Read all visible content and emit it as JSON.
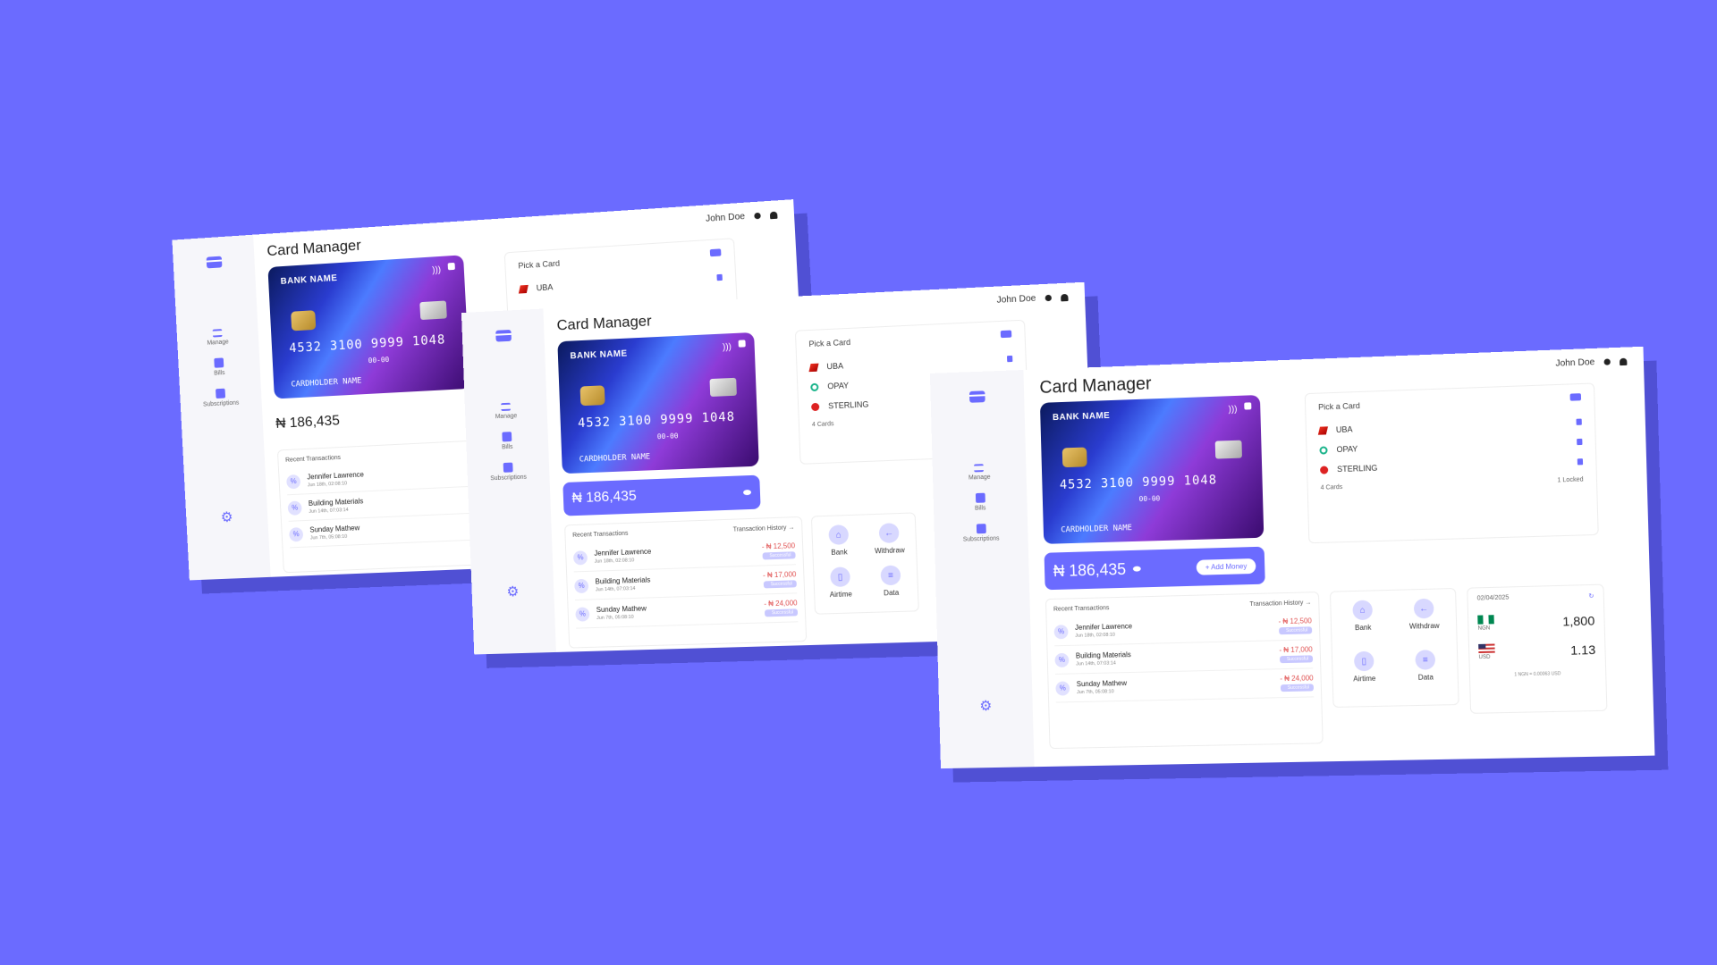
{
  "app": {
    "title": "Card Manager",
    "user": "John Doe"
  },
  "nav": {
    "manage": "Manage",
    "bills": "Bills",
    "subscriptions": "Subscriptions"
  },
  "card": {
    "bank": "BANK NAME",
    "number": "4532 3100 9999 1048",
    "short": "4532",
    "expiry": "00-00",
    "holder": "CARDHOLDER NAME"
  },
  "balance": {
    "amount": "₦ 186,435",
    "add_label": "+ Add Money"
  },
  "transactions": {
    "heading": "Recent Transactions",
    "history_link": "Transaction History →",
    "items": [
      {
        "name": "Jennifer Lawrence",
        "date": "Jun 18th, 02:08:10",
        "amount": "- ₦ 12,500",
        "status": "Successful"
      },
      {
        "name": "Building Materials",
        "date": "Jun 14th, 07:03:14",
        "amount": "- ₦ 17,000",
        "status": "Successful"
      },
      {
        "name": "Sunday Mathew",
        "date": "Jun 7th, 05:08:10",
        "amount": "- ₦ 24,000",
        "status": "Successful"
      }
    ]
  },
  "pick": {
    "heading": "Pick a Card",
    "banks": [
      "UBA",
      "OPAY",
      "STERLING"
    ],
    "cards_count": "4 Cards",
    "locked_count": "1 Locked"
  },
  "actions": {
    "bank": "Bank",
    "withdraw": "Withdraw",
    "airtime": "Airtime",
    "data": "Data"
  },
  "fx": {
    "date": "02/04/2025",
    "ngn_code": "NGN",
    "ngn_value": "1,800",
    "usd_code": "USD",
    "usd_value": "1.13",
    "note": "1 NGN = 0.00063 USD"
  },
  "colors": {
    "background": "#6b6bff",
    "accent": "#6b6bff",
    "surface": "#ffffff"
  }
}
